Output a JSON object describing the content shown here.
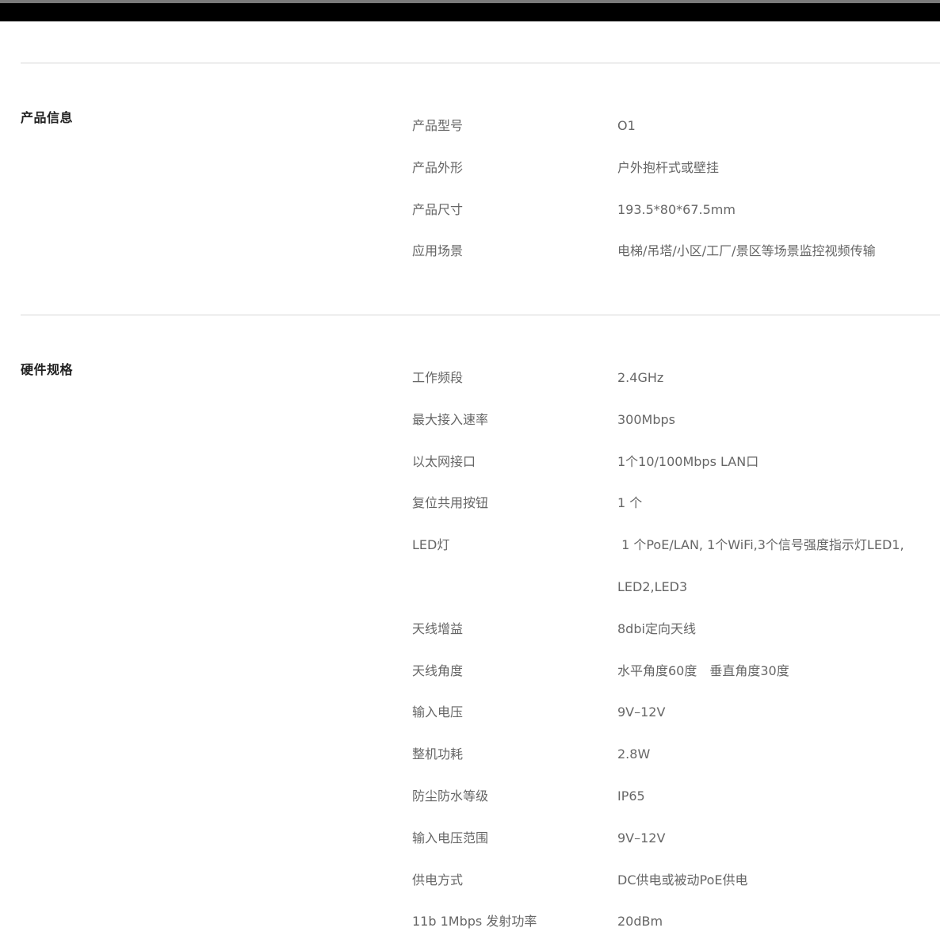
{
  "sections": [
    {
      "title": "产品信息",
      "rows": [
        {
          "label": "产品型号",
          "value": "O1"
        },
        {
          "label": "产品外形",
          "value": "户外抱杆式或壁挂"
        },
        {
          "label": "产品尺寸",
          "value": "193.5*80*67.5mm"
        },
        {
          "label": "应用场景",
          "value": "电梯/吊塔/小区/工厂/景区等场景监控视频传输"
        }
      ]
    },
    {
      "title": "硬件规格",
      "rows": [
        {
          "label": "工作频段",
          "value": "2.4GHz"
        },
        {
          "label": "最大接入速率",
          "value": "300Mbps"
        },
        {
          "label": "以太网接口",
          "value": "1个10/100Mbps LAN口"
        },
        {
          "label": "复位共用按钮",
          "value": "1 个"
        },
        {
          "label": "LED灯",
          "value": " 1 个PoE/LAN, 1个WiFi,3个信号强度指示灯LED1,"
        },
        {
          "label": "",
          "value": "LED2,LED3"
        },
        {
          "label": "天线增益",
          "value": "8dbi定向天线"
        },
        {
          "label": "天线角度",
          "value": "水平角度60度　垂直角度30度"
        },
        {
          "label": "输入电压",
          "value": "9V–12V"
        },
        {
          "label": "整机功耗",
          "value": "2.8W"
        },
        {
          "label": "防尘防水等级",
          "value": "IP65"
        },
        {
          "label": "输入电压范围",
          "value": "9V–12V"
        },
        {
          "label": "供电方式",
          "value": "DC供电或被动PoE供电"
        },
        {
          "label": "11b 1Mbps 发射功率",
          "value": "20dBm"
        }
      ]
    }
  ]
}
